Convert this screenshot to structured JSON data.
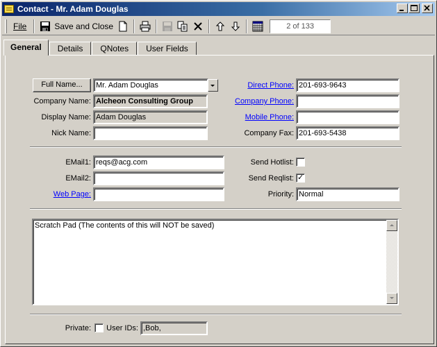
{
  "window": {
    "title": "Contact - Mr. Adam Douglas"
  },
  "toolbar": {
    "file_label": "File",
    "save_close_label": "Save and Close",
    "record_counter": "2 of 133"
  },
  "tabs": [
    {
      "label": "General",
      "active": true
    },
    {
      "label": "Details"
    },
    {
      "label": "QNotes"
    },
    {
      "label": "User Fields"
    }
  ],
  "general": {
    "full_name_button": "Full Name...",
    "full_name_value": "Mr. Adam Douglas",
    "company_name_label": "Company Name:",
    "company_name_value": "Alcheon Consulting Group",
    "display_name_label": "Display Name:",
    "display_name_value": "Adam Douglas",
    "nick_name_label": "Nick Name:",
    "nick_name_value": "",
    "direct_phone_label": "Direct Phone:",
    "direct_phone_value": "201-693-9643",
    "company_phone_label": "Company Phone:",
    "company_phone_value": "",
    "mobile_phone_label": "Mobile Phone:",
    "mobile_phone_value": "",
    "company_fax_label": "Company Fax:",
    "company_fax_value": "201-693-5438",
    "email1_label": "EMail1:",
    "email1_value": "reqs@acg.com",
    "email2_label": "EMail2:",
    "email2_value": "",
    "web_page_label": "Web Page:",
    "web_page_value": "",
    "send_hotlist_label": "Send Hotlist:",
    "send_hotlist_checked": false,
    "send_reqlist_label": "Send Reqlist:",
    "send_reqlist_checked": true,
    "priority_label": "Priority:",
    "priority_value": "Normal",
    "scratch_pad": "Scratch Pad (The contents of this will NOT be saved)",
    "private_label": "Private:",
    "private_checked": false,
    "user_ids_label": "User IDs:",
    "user_ids_value": ",Bob,"
  },
  "colors": {
    "title_bar": "#0a246a",
    "link": "#0000ff",
    "face": "#d4d0c8"
  }
}
